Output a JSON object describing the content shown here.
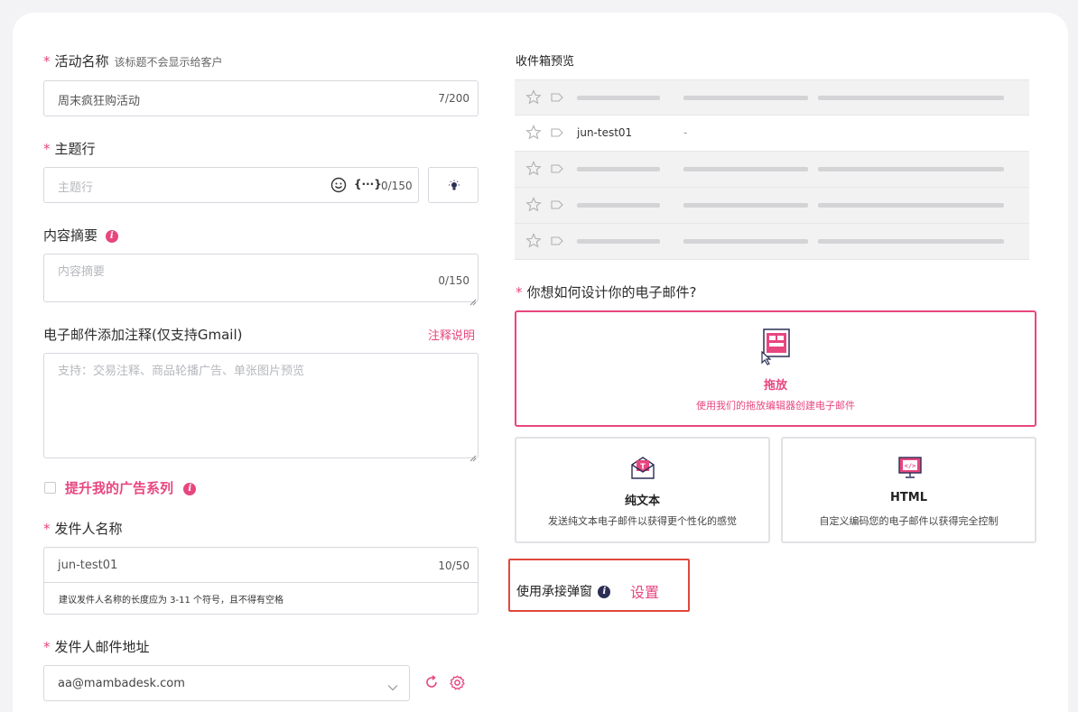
{
  "campaign": {
    "label": "活动名称",
    "hint": "该标题不会显示给客户",
    "value": "周末疯狂购活动",
    "count": "7/200"
  },
  "subject": {
    "label": "主题行",
    "placeholder": "主题行",
    "var_glyph": "{···}",
    "count": "0/150"
  },
  "summary": {
    "label": "内容摘要",
    "placeholder": "内容摘要",
    "count": "0/150"
  },
  "annotation": {
    "label": "电子邮件添加注释(仅支持Gmail)",
    "link": "注释说明",
    "placeholder": "支持：交易注释、商品轮播广告、单张图片预览"
  },
  "boost": {
    "label": "提升我的广告系列"
  },
  "sender_name": {
    "label": "发件人名称",
    "value": "jun-test01",
    "count": "10/50",
    "note": "建议发件人名称的长度应为 3-11 个符号，且不得有空格"
  },
  "sender_email": {
    "label": "发件人邮件地址",
    "value": "aa@mambadesk.com"
  },
  "inbox": {
    "title": "收件箱预览",
    "sender": "jun-test01",
    "snippet": "-"
  },
  "design": {
    "question": "你想如何设计你的电子邮件?",
    "options": [
      {
        "title": "拖放",
        "desc": "使用我们的拖放编辑器创建电子邮件",
        "icon": "drag-drop-icon"
      },
      {
        "title": "纯文本",
        "desc": "发送纯文本电子邮件以获得更个性化的感觉",
        "icon": "envelope-text-icon"
      },
      {
        "title": "HTML",
        "desc": "自定义编码您的电子邮件以获得完全控制",
        "icon": "html-monitor-icon"
      }
    ]
  },
  "popup": {
    "label": "使用承接弹窗",
    "link": "设置"
  },
  "colors": {
    "accent": "#e8467f",
    "highlight_border": "#e0483c"
  }
}
